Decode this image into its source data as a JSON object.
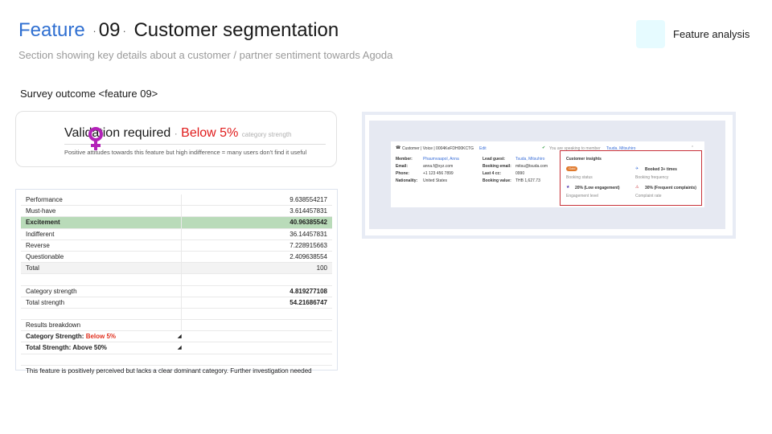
{
  "header": {
    "feature_word": "Feature",
    "number": "09",
    "dot": "·",
    "title_rest": "Customer segmentation",
    "subtitle": "Section showing key details about a customer / partner sentiment towards Agoda",
    "right_label": "Feature analysis",
    "swatch_color": "#e6fbff"
  },
  "survey": {
    "heading": "Survey outcome <feature 09>"
  },
  "validation": {
    "headline": "Validation required",
    "separator": "·",
    "status": "Below 5%",
    "status_color": "#e01b1b",
    "status_suffix": "category strength",
    "note": "Positive attitudes towards this feature but high indifference =  many users don't find it useful",
    "icon": "venus-icon"
  },
  "sheet": {
    "rows": [
      {
        "label": "Performance",
        "value": "9.638554217"
      },
      {
        "label": "Must-have",
        "value": "3.614457831"
      },
      {
        "label": "Excitement",
        "value": "40.96385542"
      },
      {
        "label": "Indifferent",
        "value": "36.14457831"
      },
      {
        "label": "Reverse",
        "value": "7.228915663"
      },
      {
        "label": "Questionable",
        "value": "2.409638554"
      },
      {
        "label": "Total",
        "value": "100"
      },
      {
        "label": "",
        "value": ""
      },
      {
        "label": "Category strength",
        "value": "4.819277108"
      },
      {
        "label": "Total strength",
        "value": "54.21686747"
      },
      {
        "label": "",
        "value": ""
      },
      {
        "label": "Results breakdown",
        "value": ""
      }
    ],
    "cat_strength_label": "Category Strength:",
    "cat_strength_value": "Below 5%",
    "total_strength_text": "Total Strength: Above 50%",
    "conclusion": "This feature is positively perceived but lacks a clear dominant category. Further investigation needed"
  },
  "screenshot": {
    "header_text": "Customer | Voice | 0004KeFDH00KCTG",
    "edit": "Edit",
    "banner": "You are speaking to member",
    "banner_name": "Tsuda, Mitsuhiro",
    "labels": [
      "Member:",
      "Email:",
      "Phone:",
      "Nationality:"
    ],
    "values": [
      "Phaumvaapol, Anna",
      "anna.f@xyz.com",
      "+1 123 456 7899",
      "United States"
    ],
    "labels2": [
      "Lead guest:",
      "Booking email:",
      "Last 4 cc:",
      "Booking value:"
    ],
    "values2": [
      "Tsuda, Mitsuhiro",
      "mitsu@tsuda.com",
      "0990",
      "THB 1,627.73"
    ],
    "insights_title": "Customer insights",
    "pill": "Gold",
    "booking_status": "Booking status",
    "booked": "Booked 3+ times",
    "booking_frequency": "Booking frequency",
    "engagement": "20% (Low engagement)",
    "engagement_level": "Engagement level",
    "complaints": "30% (Frequent complaints)",
    "complaint_rate": "Complaint rate",
    "highlight_color": "#c8323a"
  }
}
